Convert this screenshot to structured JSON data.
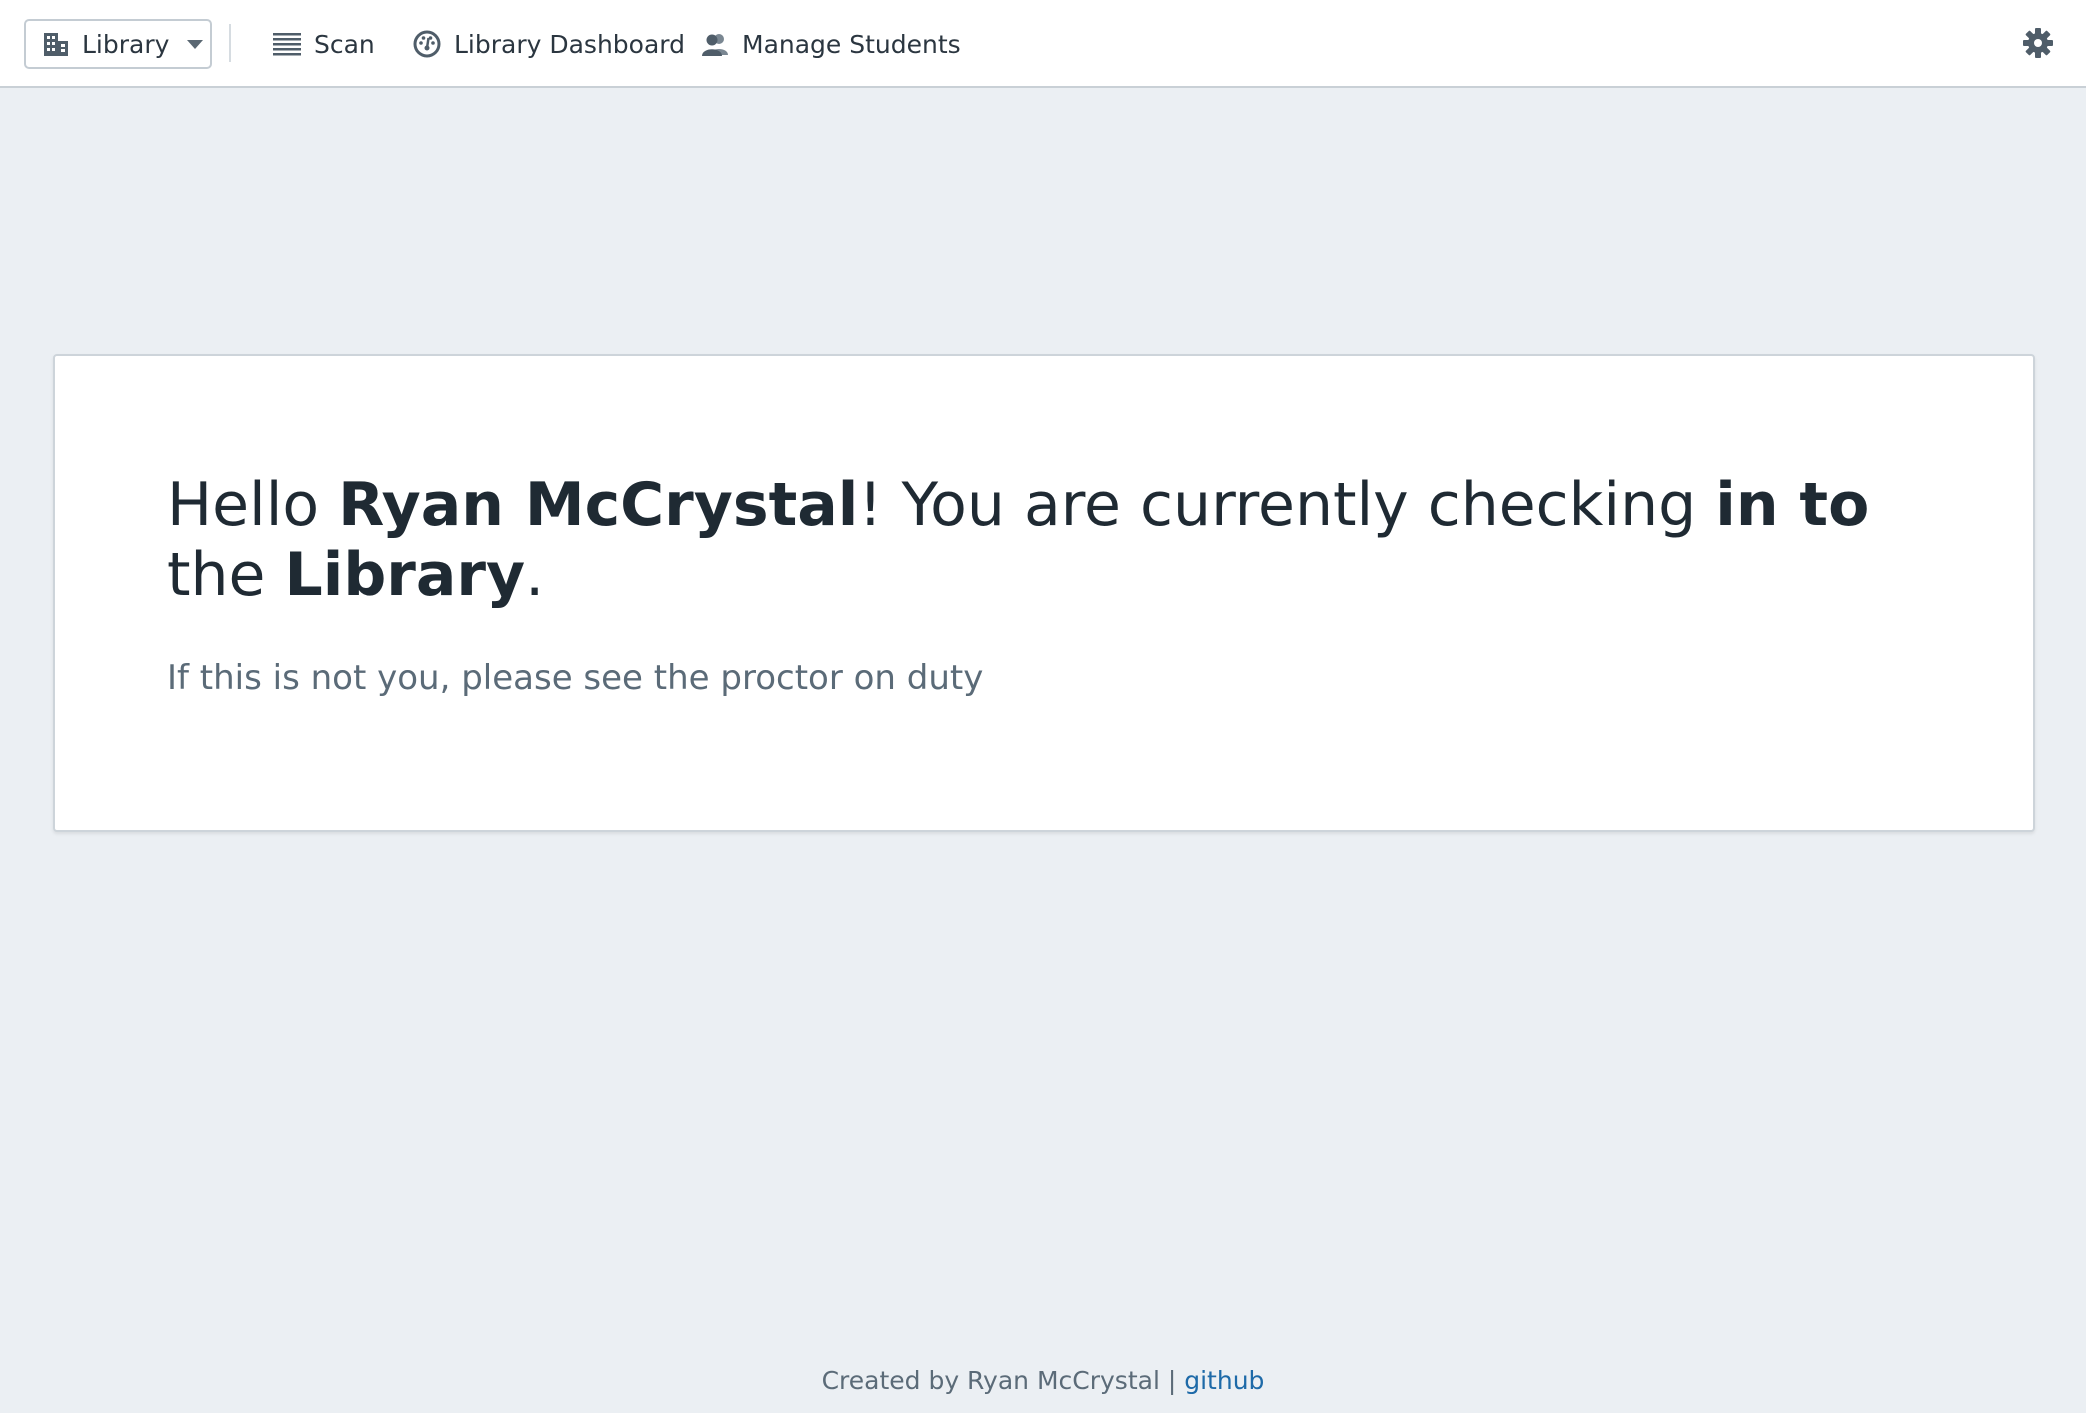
{
  "header": {
    "location_selector": {
      "label": "Library",
      "icon": "building-icon"
    },
    "nav": [
      {
        "label": "Scan",
        "icon": "barcode-list-icon"
      },
      {
        "label": "Library Dashboard",
        "icon": "dashboard-gauge-icon"
      },
      {
        "label": "Manage Students",
        "icon": "users-icon"
      }
    ],
    "settings_icon": "gear-icon"
  },
  "message": {
    "greeting_prefix": "Hello ",
    "user_name": "Ryan McCrystal",
    "middle": "! You are currently checking ",
    "direction": "in to",
    "before_location": " the ",
    "location": "Library",
    "end": ".",
    "subtext": "If this is not you, please see the proctor on duty"
  },
  "footer": {
    "created_by": "Created by Ryan McCrystal | ",
    "link_label": "github"
  },
  "colors": {
    "page_background": "#ebeff3",
    "link": "#1e6aa8",
    "muted_text": "#5b6b78"
  }
}
